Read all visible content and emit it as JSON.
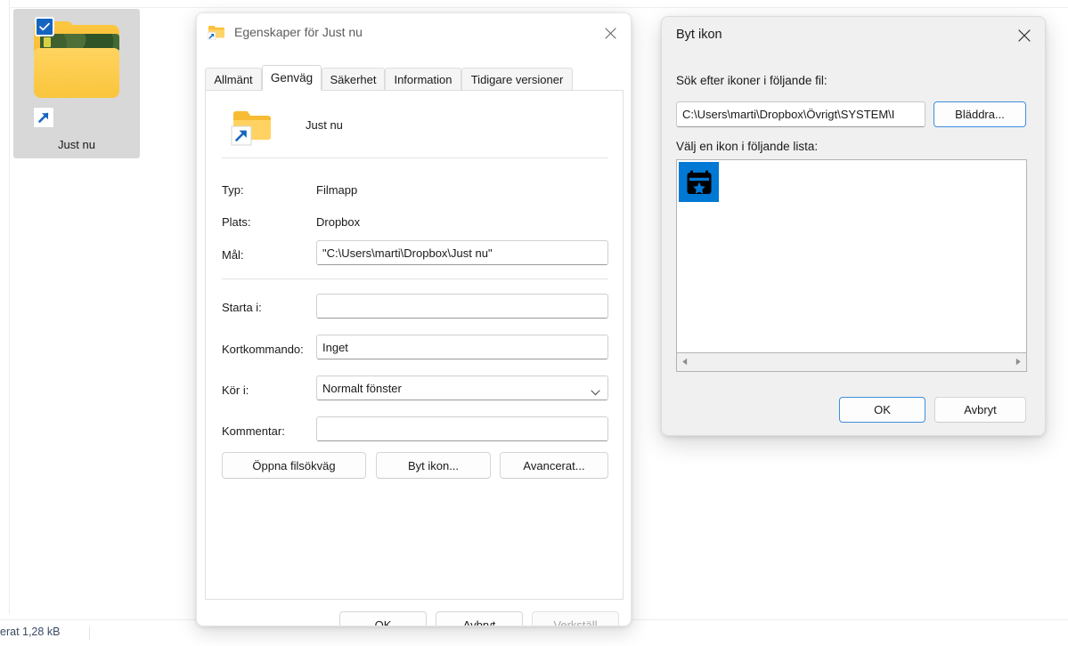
{
  "desktop": {
    "folder_tile": {
      "label": "Just nu",
      "icon_name": "folder-with-photo-thumbnail",
      "selected": true,
      "has_shortcut_overlay": true,
      "has_check_badge": true
    },
    "status_bar": {
      "text": "erat  1,28 kB"
    }
  },
  "properties_dialog": {
    "title": "Egenskaper för Just nu",
    "title_icon": "folder-shortcut-icon",
    "close_label": "✕",
    "tabs": [
      {
        "label": "Allmänt",
        "active": false
      },
      {
        "label": "Genväg",
        "active": true
      },
      {
        "label": "Säkerhet",
        "active": false
      },
      {
        "label": "Information",
        "active": false
      },
      {
        "label": "Tidigare versioner",
        "active": false
      }
    ],
    "header": {
      "icon_name": "folder-shortcut-icon",
      "name": "Just nu"
    },
    "fields": [
      {
        "label": "Typ:",
        "value": "Filmapp",
        "kind": "static"
      },
      {
        "label": "Plats:",
        "value": "Dropbox",
        "kind": "static"
      },
      {
        "label": "Mål:",
        "value": "\"C:\\Users\\marti\\Dropbox\\Just nu\"",
        "kind": "input"
      },
      {
        "label": "Starta i:",
        "value": "",
        "kind": "input"
      },
      {
        "label": "Kortkommando:",
        "value": "Inget",
        "kind": "input"
      },
      {
        "label": "Kör i:",
        "value": "Normalt fönster",
        "kind": "combo"
      },
      {
        "label": "Kommentar:",
        "value": "",
        "kind": "input"
      }
    ],
    "action_buttons": [
      {
        "label": "Öppna filsökväg",
        "disabled": false
      },
      {
        "label": "Byt ikon...",
        "disabled": false
      },
      {
        "label": "Avancerat...",
        "disabled": false
      }
    ],
    "footer_buttons": [
      {
        "label": "OK",
        "disabled": false
      },
      {
        "label": "Avbryt",
        "disabled": false
      },
      {
        "label": "Verkställ",
        "disabled": true
      }
    ]
  },
  "change_icon_dialog": {
    "title": "Byt ikon",
    "close_label": "✕",
    "search_label": "Sök efter ikoner i följande fil:",
    "path_value": "C:\\Users\\marti\\Dropbox\\Övrigt\\SYSTEM\\I",
    "browse_label": "Bläddra...",
    "list_label": "Välj en ikon i följande lista:",
    "icons": [
      {
        "name": "calendar-star-icon",
        "selected": true
      }
    ],
    "scrollbar": {
      "left_arrow": "scroll-left-arrow-icon",
      "right_arrow": "scroll-right-arrow-icon"
    },
    "buttons": [
      {
        "label": "OK",
        "focused": true
      },
      {
        "label": "Avbryt",
        "focused": false
      }
    ]
  },
  "colors": {
    "accent": "#0078d4",
    "selection_badge": "#1565c0",
    "folder_yellow": "#fcc63f",
    "dialog_gray": "#f0f0f0",
    "focus_border": "#3e8edd",
    "status_text": "#3b4a63"
  }
}
